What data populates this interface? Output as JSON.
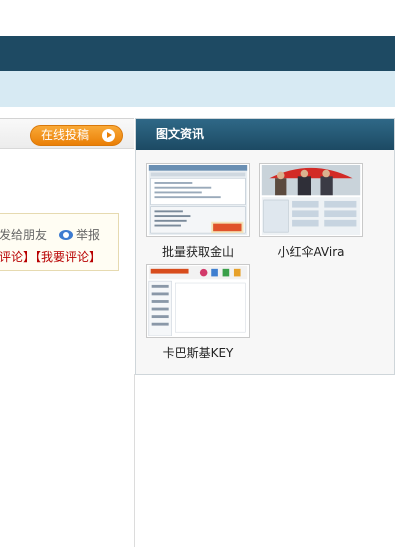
{
  "toolbar": {
    "submit_label": "在线投稿"
  },
  "article_actions": {
    "share_label": "发给朋友",
    "report_label": "举报",
    "comment_links": "评论】【我要评论】"
  },
  "panel": {
    "title": "图文资讯",
    "items": [
      {
        "caption": "批量获取金山"
      },
      {
        "caption": "小红伞AVira"
      },
      {
        "caption": "卡巴斯基KEY"
      }
    ]
  },
  "colors": {
    "header_dark": "#1e4a63",
    "sub_band": "#d7eaf3",
    "accent_orange": "#ea7f06",
    "comment_red": "#b80000"
  }
}
